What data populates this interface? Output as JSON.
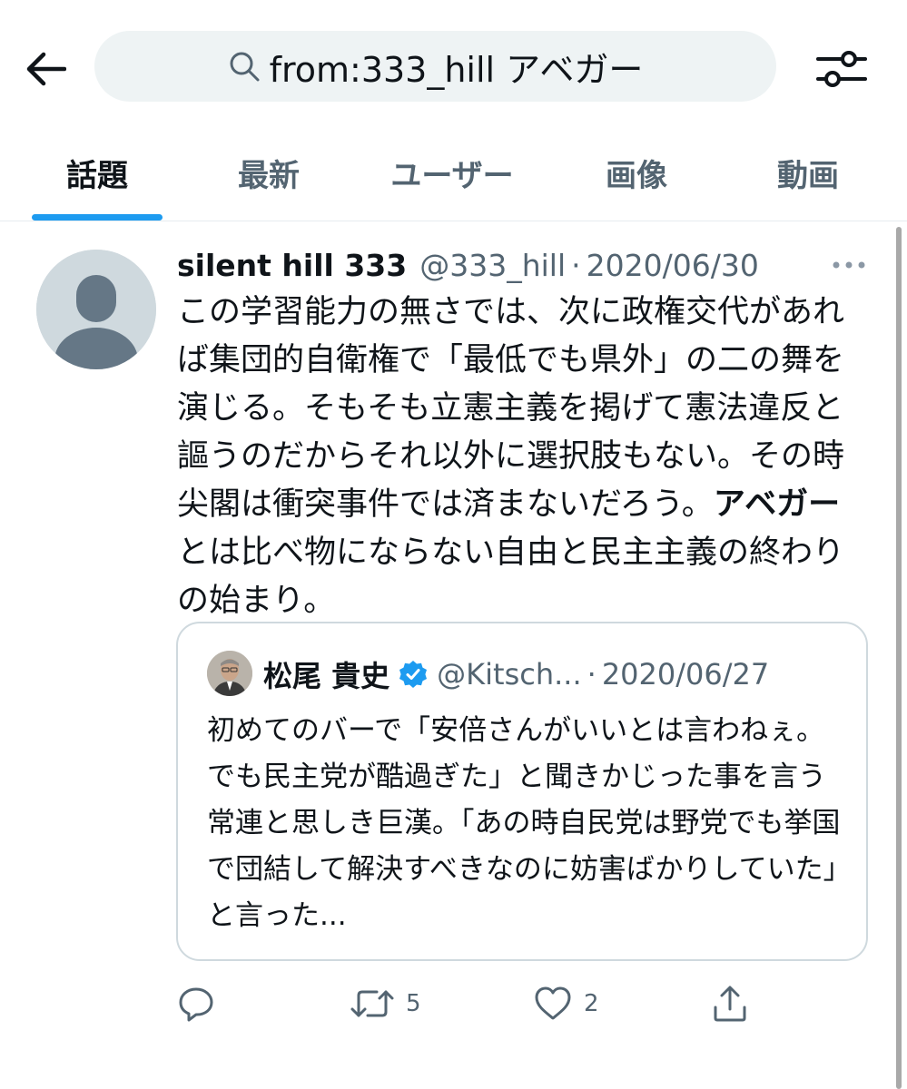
{
  "search": {
    "query": "from:333_hill アベガー",
    "back_icon": "arrow-left-icon",
    "search_icon": "search-icon",
    "filter_icon": "sliders-icon"
  },
  "tabs": [
    {
      "label": "話題",
      "active": true
    },
    {
      "label": "最新",
      "active": false
    },
    {
      "label": "ユーザー",
      "active": false
    },
    {
      "label": "画像",
      "active": false
    },
    {
      "label": "動画",
      "active": false
    }
  ],
  "tweet": {
    "author_name": "silent hill 333",
    "handle": "@333_hill",
    "separator": "·",
    "date": "2020/06/30",
    "text_before_highlight": "この学習能力の無さでは、次に政権交代があれば集団的自衛権で「最低でも県外」の二の舞を演じる。そもそも立憲主義を掲げて憲法違反と謳うのだからそれ以外に選択肢もない。その時尖閣は衝突事件では済まないだろう。",
    "highlight": "アベガー",
    "text_after_highlight": "とは比べ物にならない自由と民主主義の終わりの始まり。",
    "quoted": {
      "author_name": "松尾 貴史",
      "verified": true,
      "handle": "@Kitsch...",
      "separator": "·",
      "date": "2020/06/27",
      "text": "初めてのバーで「安倍さんがいいとは言わねぇ。でも民主党が酷過ぎた」と聞きかじった事を言う常連と思しき巨漢。「あの時自民党は野党でも挙国で団結して解決すべきなのに妨害ばかりしていた」と言った..."
    },
    "actions": {
      "reply_icon": "reply-icon",
      "retweet_icon": "retweet-icon",
      "retweet_count": "5",
      "like_icon": "heart-icon",
      "like_count": "2",
      "share_icon": "share-icon"
    }
  },
  "colors": {
    "accent": "#1d9bf0",
    "secondary_text": "#536471",
    "search_bg": "#eef3f4"
  }
}
